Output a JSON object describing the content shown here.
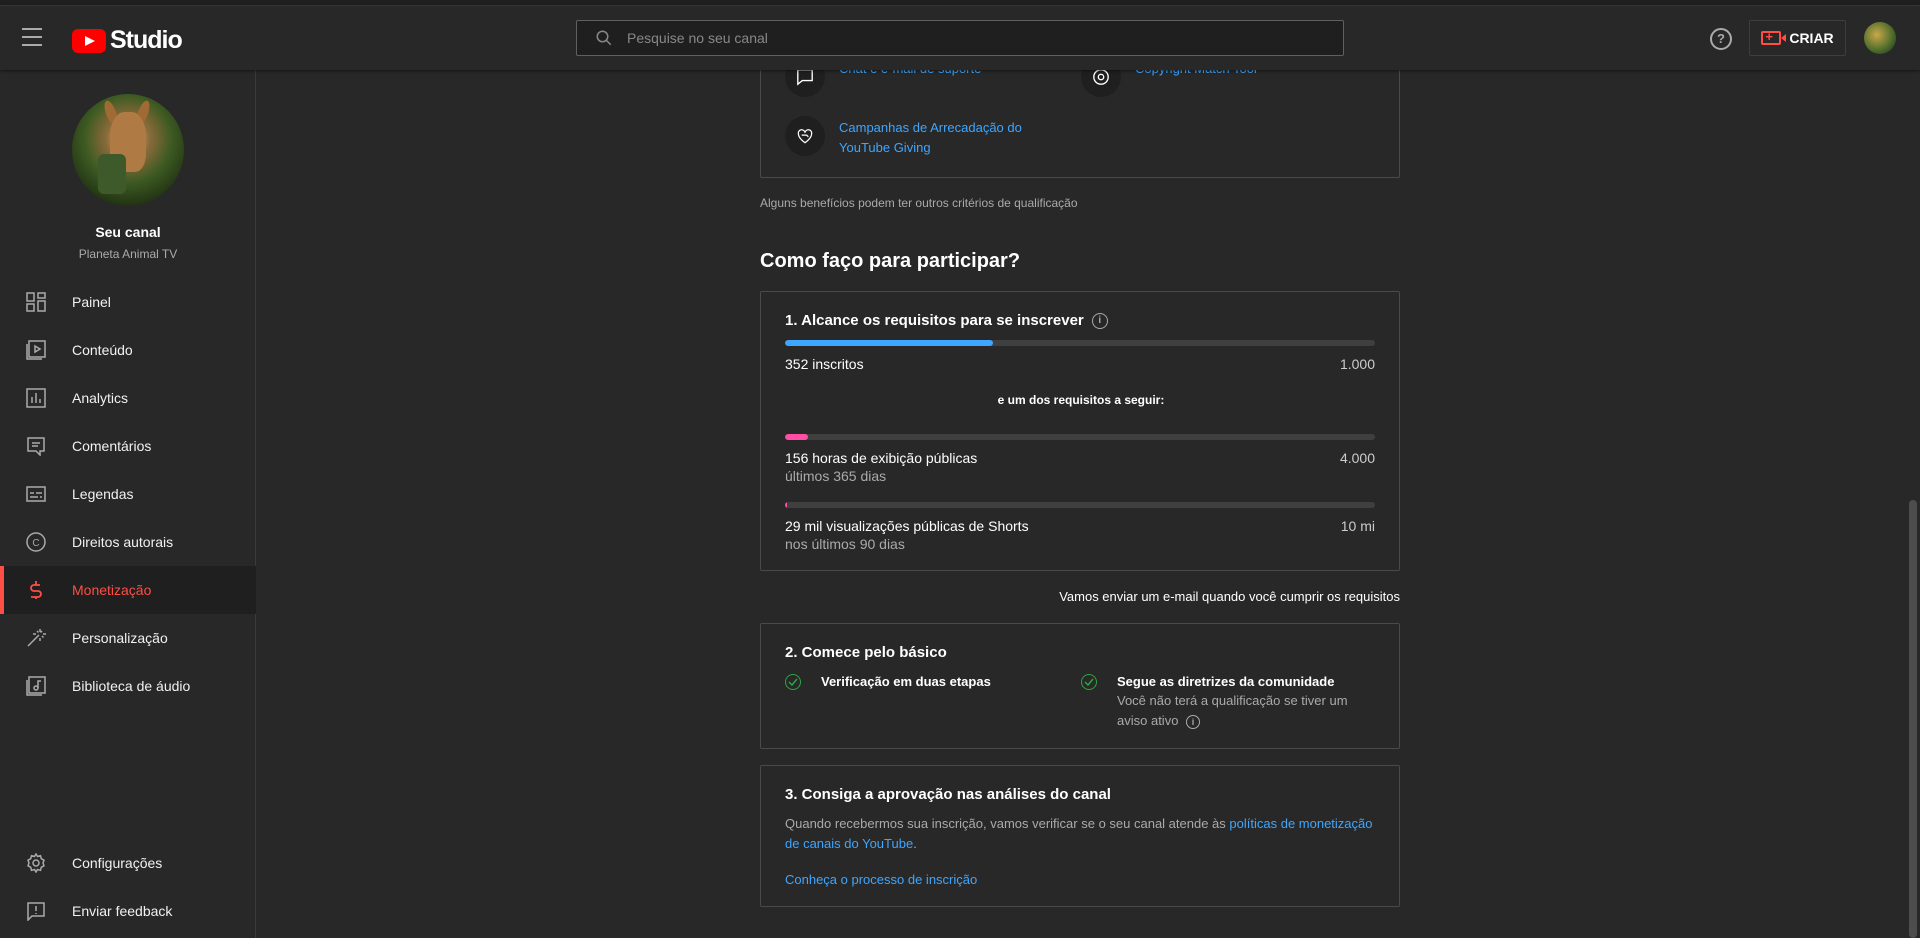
{
  "header": {
    "logo_text": "Studio",
    "search_placeholder": "Pesquise no seu canal",
    "create_label": "CRIAR",
    "help_label": "?"
  },
  "sidebar": {
    "channel_title": "Seu canal",
    "channel_name": "Planeta Animal TV",
    "items": [
      {
        "label": "Painel",
        "icon": "dashboard-icon"
      },
      {
        "label": "Conteúdo",
        "icon": "content-icon"
      },
      {
        "label": "Analytics",
        "icon": "analytics-icon"
      },
      {
        "label": "Comentários",
        "icon": "comments-icon"
      },
      {
        "label": "Legendas",
        "icon": "subtitles-icon"
      },
      {
        "label": "Direitos autorais",
        "icon": "copyright-icon"
      },
      {
        "label": "Monetização",
        "icon": "dollar-icon",
        "active": true
      },
      {
        "label": "Personalização",
        "icon": "magic-wand-icon"
      },
      {
        "label": "Biblioteca de áudio",
        "icon": "audio-library-icon"
      }
    ],
    "bottom_items": [
      {
        "label": "Configurações",
        "icon": "gear-icon"
      },
      {
        "label": "Enviar feedback",
        "icon": "feedback-icon"
      }
    ]
  },
  "benefits": {
    "chat_support": "Chat e e-mail de suporte",
    "copyright_tool": "Copyright Match Tool",
    "giving": "Campanhas de Arrecadação do YouTube Giving",
    "note": "Alguns benefícios podem ter outros critérios de qualificação"
  },
  "how_to": {
    "heading": "Como faço para participar?",
    "step1": {
      "title": "1. Alcance os requisitos para se inscrever",
      "subscribers_label": "352 inscritos",
      "subscribers_goal": "1.000",
      "subscribers_progress": 0.352,
      "subscribers_color": "#3ea6ff",
      "one_of": "e um dos requisitos a seguir:",
      "hours_label": "156 horas de exibição públicas",
      "hours_sub": "últimos 365 dias",
      "hours_goal": "4.000",
      "hours_progress": 0.039,
      "hours_color": "#ff4ea3",
      "shorts_label": "29 mil visualizações públicas de Shorts",
      "shorts_sub": "nos últimos 90 dias",
      "shorts_goal": "10 mi",
      "shorts_progress": 0.0029
    },
    "email_note": "Vamos enviar um e-mail quando você cumprir os requisitos",
    "step2": {
      "title": "2. Comece pelo básico",
      "two_step": "Verificação em duas etapas",
      "guidelines": "Segue as diretrizes da comunidade",
      "guidelines_sub": "Você não terá a qualificação se tiver um aviso ativo"
    },
    "step3": {
      "title": "3. Consiga a aprovação nas análises do canal",
      "desc_before": "Quando recebermos sua inscrição, vamos verificar se o seu canal atende às ",
      "desc_link": "políticas de monetização de canais do YouTube",
      "desc_after": ".",
      "process_link": "Conheça o processo de inscrição"
    }
  }
}
